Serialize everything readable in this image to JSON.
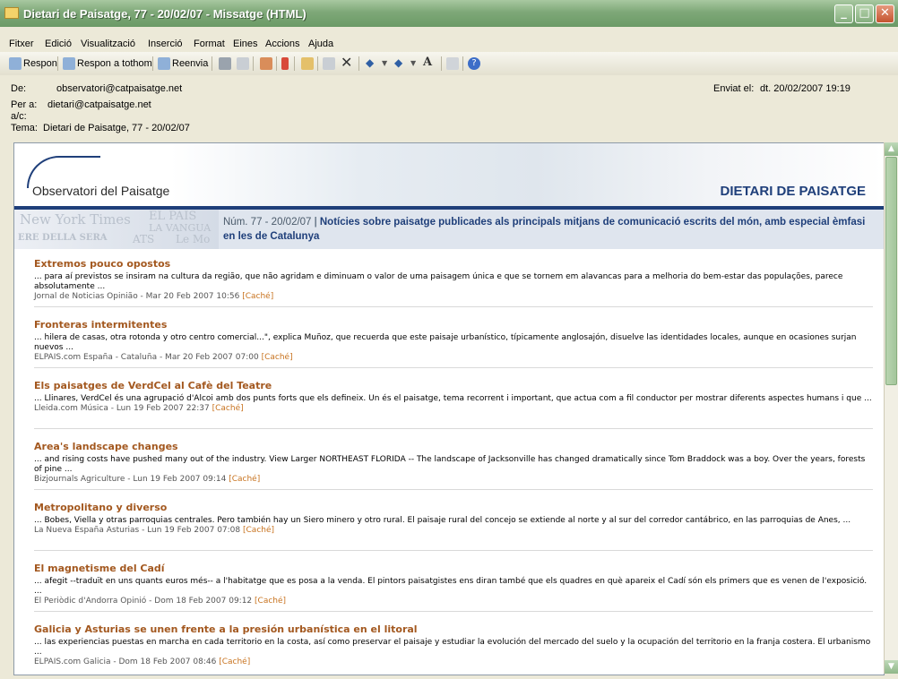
{
  "window": {
    "title": "Dietari de Paisatge, 77 - 20/02/07 - Missatge (HTML)",
    "min_icon": "minimize-icon",
    "max_icon": "maximize-icon",
    "close_icon": "close-icon"
  },
  "menu": [
    "Fitxer",
    "Edició",
    "Visualització",
    "Inserció",
    "Format",
    "Eines",
    "Accions",
    "Ajuda"
  ],
  "toolbar": {
    "reply": "Respon",
    "reply_all": "Respon a tothom",
    "forward": "Reenvia"
  },
  "header": {
    "from_label": "De:",
    "from_value": "observatori@catpaisatge.net",
    "to_label": "Per a:",
    "to_value": "dietari@catpaisatge.net",
    "cc_label": "a/c:",
    "subject_label": "Tema:",
    "subject_value": "Dietari de Paisatge, 77 - 20/02/07",
    "sent_label": "Enviat el:",
    "sent_value": "dt. 20/02/2007 19:19"
  },
  "newsletter": {
    "logo_text": "Observatori del Paisatge",
    "title": "DIETARI DE PAISATGE",
    "issue": "Núm. 77 - 20/02/07",
    "sep": "|",
    "description": "Notícies sobre paisatge publicades als principals mitjans de comunicació escrits del món, amb especial èmfasi en les de Catalunya",
    "bg_words": [
      "New York Times",
      "EL PAIS",
      "LA VANGUA",
      "ERE DELLA SERA",
      "ATS",
      "Le Mo"
    ]
  },
  "articles": [
    {
      "title": "Extremos pouco opostos",
      "snippet": "... para aí previstos se insiram na cultura da região, que não agridam e diminuam o valor de uma paisagem única e que se tornem em alavancas para a melhoria do bem-estar das populações, parece absolutamente ...",
      "source": "Jornal de Noticias Opinião - Mar 20 Feb 2007 10:56",
      "cache": "[Caché]"
    },
    {
      "title": "Fronteras intermitentes",
      "snippet": "... hilera de casas, otra rotonda y otro centro comercial...\", explica Muñoz, que recuerda que este paisaje urbanístico, típicamente anglosajón, disuelve las identidades locales, aunque en ocasiones surjan nuevos ...",
      "source": "ELPAIS.com España - Cataluña - Mar 20 Feb 2007 07:00",
      "cache": "[Caché]"
    },
    {
      "title": "Els paisatges de VerdCel al Cafè del Teatre",
      "snippet": "... Llinares, VerdCel és una agrupació d'Alcoi amb dos punts forts que els defineix. Un és el paisatge, tema recorrent i important, que actua com a fil conductor per mostrar diferents aspectes humans i que ...",
      "source": "Lleida.com Música - Lun 19 Feb 2007 22:37",
      "cache": "[Caché]"
    },
    {
      "title": "Area's landscape changes",
      "snippet": "... and rising costs have pushed many out of the industry. View Larger NORTHEAST FLORIDA -- The landscape of Jacksonville has changed dramatically since Tom Braddock was a boy. Over the years, forests of pine ...",
      "source": "Bizjournals Agriculture - Lun 19 Feb 2007 09:14",
      "cache": "[Caché]"
    },
    {
      "title": "Metropolitano y diverso",
      "snippet": "... Bobes, Viella y otras parroquias centrales. Pero también hay un Siero minero y otro rural. El paisaje rural del concejo se extiende al norte y al sur del corredor cantábrico, en las parroquias de Anes, ...",
      "source": "La Nueva España Asturias - Lun 19 Feb 2007 07:08",
      "cache": "[Caché]"
    },
    {
      "title": "El magnetisme del Cadí",
      "snippet": "... afegit --traduït en uns quants euros més-- a l'habitatge que es posa a la venda. El pintors paisatgistes ens diran també que els quadres en què apareix el Cadí són els primers que es venen de l'exposició. ...",
      "source": "El Periòdic d'Andorra Opinió - Dom 18 Feb 2007 09:12",
      "cache": "[Caché]"
    },
    {
      "title": "Galicia y Asturias se unen frente a la presión urbanística en el litoral",
      "snippet": "... las experiencias puestas en marcha en cada territorio en la costa, así como preservar el paisaje y estudiar la evolución del mercado del suelo y la ocupación del territorio en la franja costera. El urbanismo ...",
      "source": "ELPAIS.com Galicia - Dom 18 Feb 2007 08:46",
      "cache": "[Caché]"
    }
  ]
}
